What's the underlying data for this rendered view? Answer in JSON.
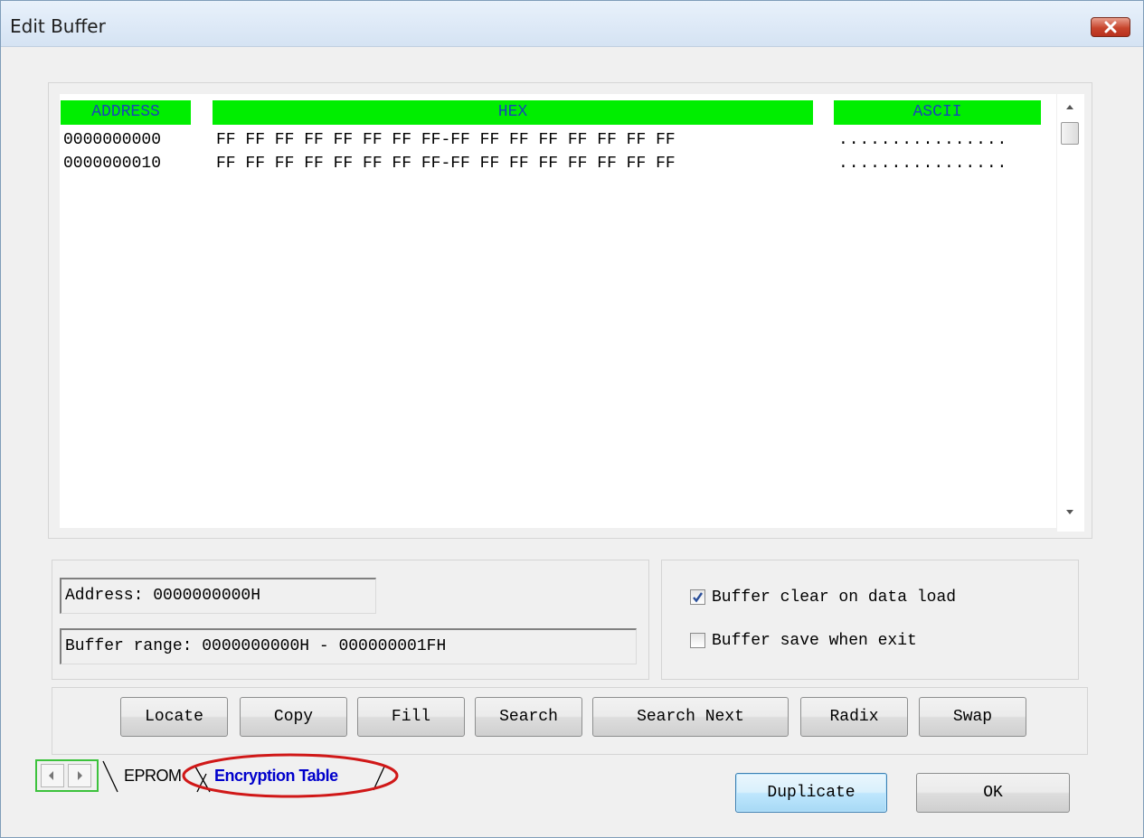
{
  "window": {
    "title": "Edit Buffer",
    "close_icon": "close-icon"
  },
  "hexview": {
    "headers": {
      "address": "ADDRESS",
      "hex": "HEX",
      "ascii": "ASCII"
    },
    "rows": [
      {
        "address": "0000000000",
        "hex": "FF FF FF FF FF FF FF FF-FF FF FF FF FF FF FF FF",
        "ascii": "................"
      },
      {
        "address": "0000000010",
        "hex": "FF FF FF FF FF FF FF FF-FF FF FF FF FF FF FF FF",
        "ascii": "................"
      }
    ],
    "header_color": "#00ee00",
    "header_text_color": "#1a44b8"
  },
  "info": {
    "address": "Address: 0000000000H",
    "buffer_range": "Buffer range: 0000000000H - 000000001FH"
  },
  "options": {
    "clear_on_load": {
      "label": "Buffer clear on data load",
      "checked": true
    },
    "save_on_exit": {
      "label": "Buffer save when exit",
      "checked": false
    }
  },
  "buttons": {
    "locate": "Locate",
    "copy": "Copy",
    "fill": "Fill",
    "search": "Search",
    "search_next": "Search Next",
    "radix": "Radix",
    "swap": "Swap",
    "duplicate": "Duplicate",
    "ok": "OK"
  },
  "tabs": {
    "eprom": "EPROM",
    "encryption_table": "Encryption Table",
    "active_tab_text_color": "#0000cc",
    "highlight_color": "#d01818"
  }
}
